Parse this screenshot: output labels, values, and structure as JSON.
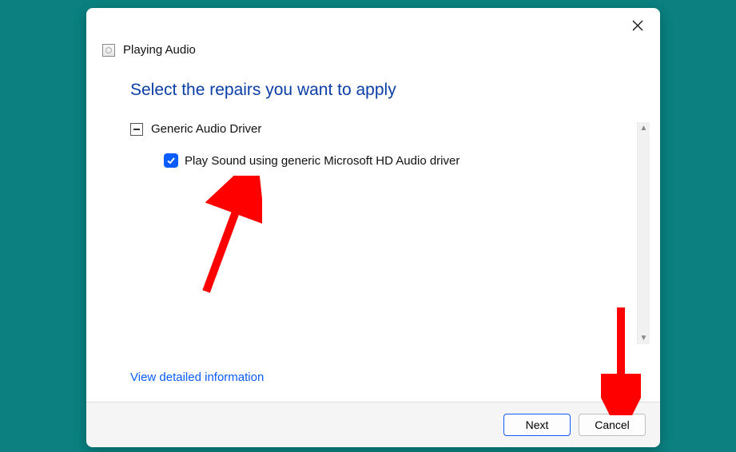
{
  "window": {
    "title": "Playing Audio"
  },
  "main": {
    "instruction": "Select the repairs you want to apply",
    "group": {
      "label": "Generic Audio Driver"
    },
    "item": {
      "label": "Play Sound using generic Microsoft HD Audio driver",
      "checked": true
    },
    "detail_link": "View detailed information"
  },
  "footer": {
    "next": "Next",
    "cancel": "Cancel"
  }
}
